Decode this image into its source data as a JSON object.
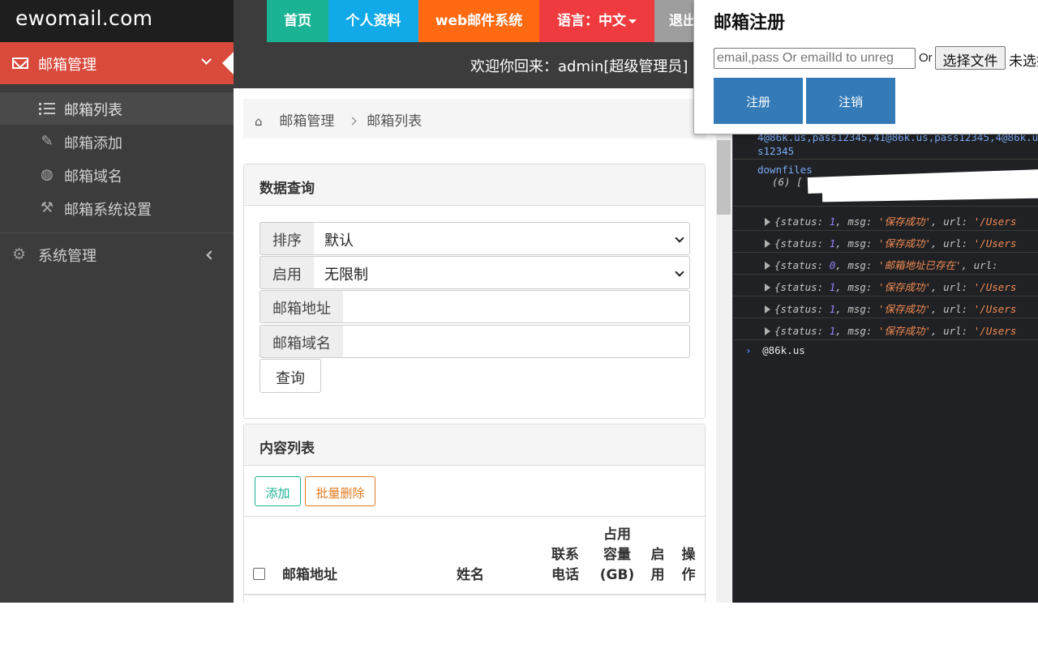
{
  "brand": "ewomail.com",
  "topnav": {
    "home": "首页",
    "profile": "个人资料",
    "webmail": "web邮件系统",
    "language": "语言：中文",
    "logout": "退出"
  },
  "welcome": "欢迎你回来：admin[超级管理员]",
  "sidebar": {
    "active_menu": "邮箱管理",
    "items": [
      "邮箱列表",
      "邮箱添加",
      "邮箱域名",
      "邮箱系统设置"
    ],
    "system": "系统管理"
  },
  "breadcrumb": [
    "邮箱管理",
    "邮箱列表"
  ],
  "query_panel": {
    "title": "数据查询",
    "sort_label": "排序",
    "sort_value": "默认",
    "enabled_label": "启用",
    "enabled_value": "无限制",
    "address_label": "邮箱地址",
    "domain_label": "邮箱域名",
    "query_button": "查询"
  },
  "list_panel": {
    "title": "内容列表",
    "add_button": "添加",
    "batch_delete_button": "批量删除",
    "columns": {
      "address": "邮箱地址",
      "name": "姓名",
      "phone": [
        "联系",
        "电话"
      ],
      "quota": [
        "占用",
        "容量",
        "(GB)"
      ],
      "enabled": [
        "启",
        "用"
      ],
      "action": [
        "操",
        "作"
      ]
    }
  },
  "popup": {
    "title": "邮箱注册",
    "input_placeholder": "email,pass Or emailId to unreg",
    "or_text": "Or",
    "file_button": "选择文件",
    "no_file_text": "未选择任何文件",
    "register_button": "注册",
    "unregister_button": "注销"
  },
  "console": {
    "line_top_1": "4@86k.us,pass12345,41@86k.us,pass12345,4@86k.u",
    "line_top_2": "s12345",
    "downfiles_label": "downfiles",
    "array_preview": "(6) [",
    "entries": [
      {
        "status": "1",
        "msg": "'保存成功'",
        "url": "'/Users"
      },
      {
        "status": "1",
        "msg": "'保存成功'",
        "url": "'/Users"
      },
      {
        "status": "0",
        "msg": "'邮箱地址已存在'",
        "url": ""
      },
      {
        "status": "1",
        "msg": "'保存成功'",
        "url": "'/Users"
      },
      {
        "status": "1",
        "msg": "'保存成功'",
        "url": "'/Users"
      },
      {
        "status": "1",
        "msg": "'保存成功'",
        "url": "'/Users"
      }
    ],
    "prompt_input": "@86k.us"
  }
}
